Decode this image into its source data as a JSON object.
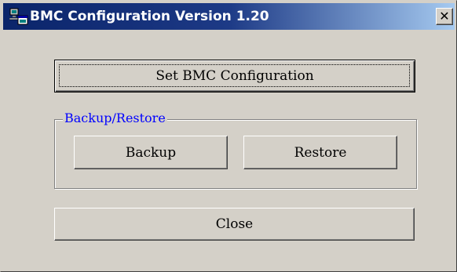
{
  "window": {
    "title": "BMC Configuration Version 1.20",
    "close_glyph": "✕",
    "app_icon": "computer-window-icon"
  },
  "buttons": {
    "set_bmc": "Set BMC Configuration",
    "backup": "Backup",
    "restore": "Restore",
    "close": "Close"
  },
  "group": {
    "legend": "Backup/Restore"
  },
  "colors": {
    "face": "#d4d0c8",
    "titlebar_start": "#0a246a",
    "titlebar_end": "#a6caf0",
    "group_label": "#0000ff"
  }
}
